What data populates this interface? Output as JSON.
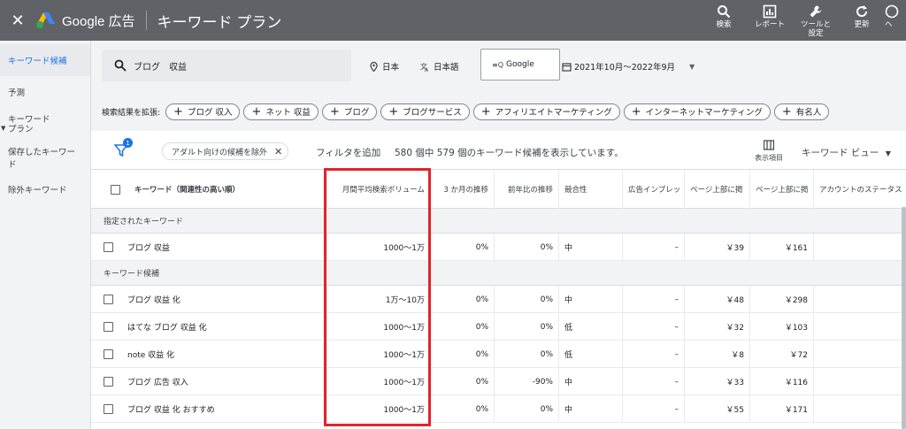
{
  "topbar": {
    "close": "✕",
    "brand": "Google 広告",
    "title": "キーワード プラン",
    "actions": [
      {
        "label": "検索",
        "icon": "search-icon"
      },
      {
        "label": "レポート",
        "icon": "report-icon"
      },
      {
        "label": "ツールと\n設定",
        "icon": "wrench-icon"
      },
      {
        "label": "更新",
        "icon": "refresh-icon"
      },
      {
        "label": "ヘ",
        "icon": "help-icon"
      }
    ]
  },
  "sidebar": {
    "items": [
      "キーワード候補",
      "予測",
      "キーワード\nプラン",
      "保存したキーワード",
      "除外キーワード"
    ]
  },
  "search": {
    "query": "ブログ　収益",
    "location": "日本",
    "language": "日本語",
    "network": "Google",
    "date_range": "2021年10月～2022年9月"
  },
  "expand": {
    "label": "検索結果を拡張:",
    "chips": [
      "ブログ 収入",
      "ネット 収益",
      "ブログ",
      "ブログサービス",
      "アフィリエイトマーケティング",
      "インターネットマーケティング",
      "有名人"
    ]
  },
  "filters": {
    "badge": "1",
    "adult_chip": "アダルト向けの候補を除外",
    "add_filter": "フィルタを追加",
    "count_text": "580 個中 579 個のキーワード候補を表示しています。",
    "columns_label": "表示項目",
    "view_label": "キーワード ビュー"
  },
  "table": {
    "headers": [
      "キーワード（関連性の高い順）",
      "月間平均検索ボリューム",
      "3 か月の推移",
      "前年比の推移",
      "競合性",
      "広告インプレッ",
      "ページ上部に掲",
      "ページ上部に掲",
      "アカウントのステータス"
    ],
    "sections": [
      {
        "title": "指定されたキーワード",
        "rows": [
          [
            "ブログ 収益",
            "1000～1万",
            "0%",
            "0%",
            "中",
            "–",
            "￥39",
            "￥161",
            ""
          ]
        ]
      },
      {
        "title": "キーワード候補",
        "rows": [
          [
            "ブログ 収益 化",
            "1万～10万",
            "0%",
            "0%",
            "中",
            "–",
            "￥48",
            "￥298",
            ""
          ],
          [
            "はてな ブログ 収益 化",
            "1000～1万",
            "0%",
            "0%",
            "低",
            "–",
            "￥32",
            "￥103",
            ""
          ],
          [
            "note 収益 化",
            "1000～1万",
            "0%",
            "0%",
            "低",
            "–",
            "￥8",
            "￥72",
            ""
          ],
          [
            "ブログ 広告 収入",
            "1000～1万",
            "0%",
            "-90%",
            "中",
            "–",
            "￥33",
            "￥116",
            ""
          ],
          [
            "ブログ 収益 化 おすすめ",
            "1000～1万",
            "0%",
            "0%",
            "中",
            "–",
            "￥55",
            "￥171",
            ""
          ]
        ]
      }
    ]
  },
  "colors": {
    "topbar": "#5f6368",
    "accent": "#1a73e8",
    "highlight": "#e0242b"
  }
}
